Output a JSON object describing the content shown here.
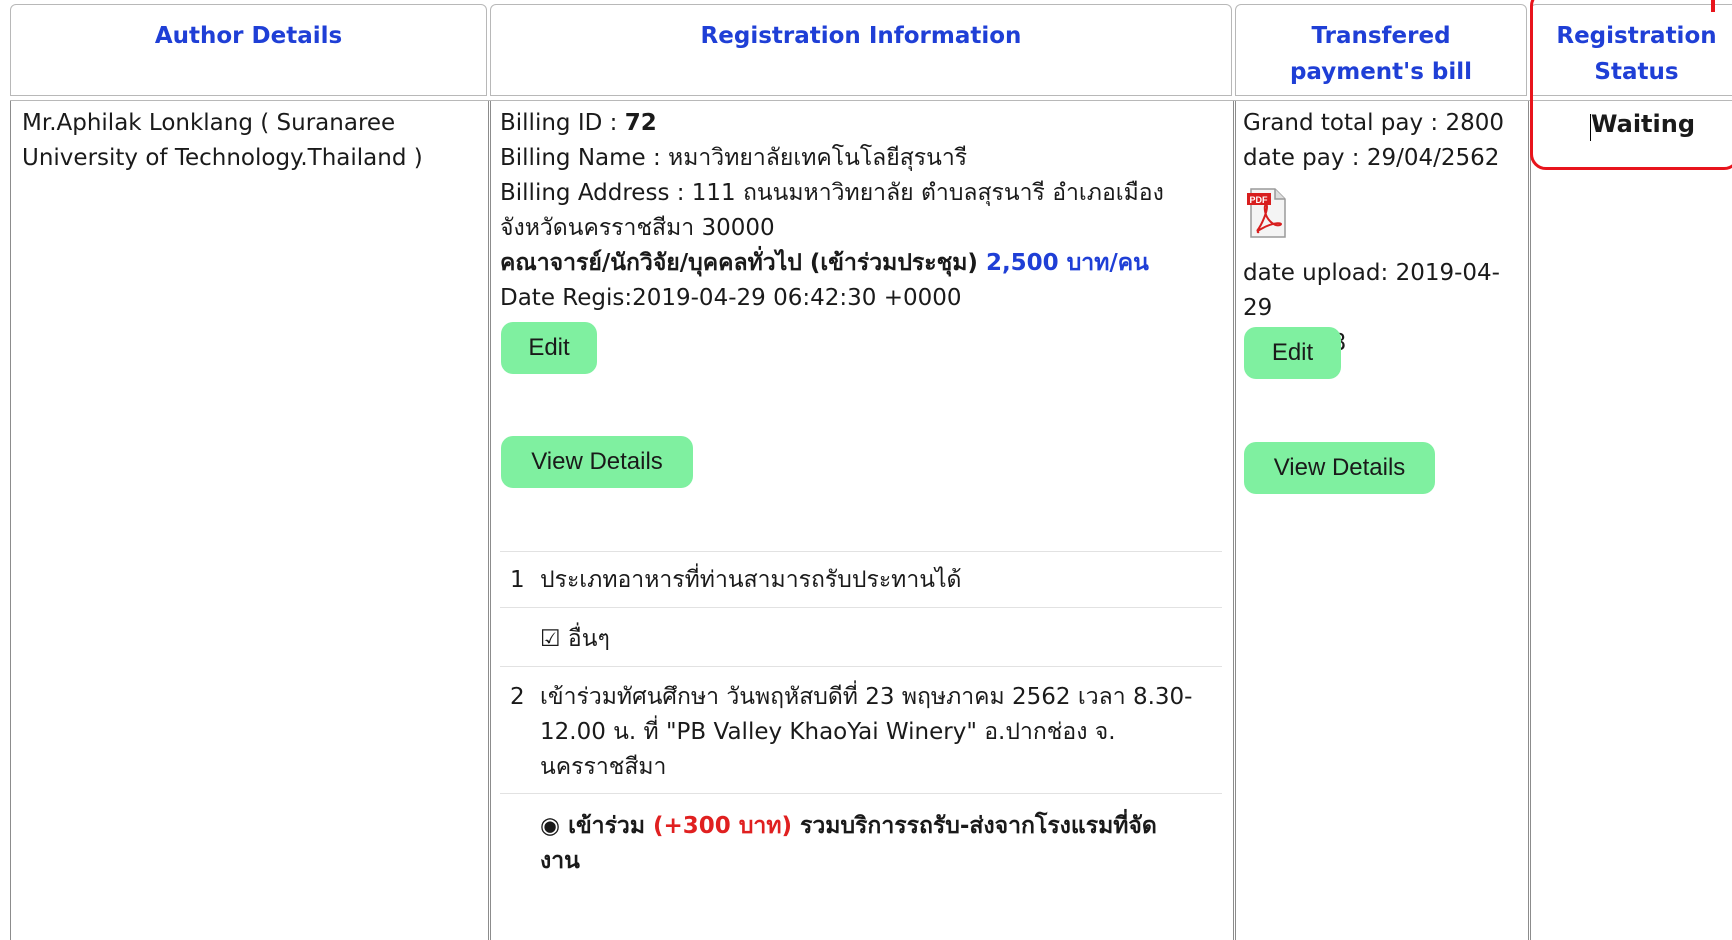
{
  "headers": {
    "author": "Author Details",
    "registration": "Registration Information",
    "bill": "Transfered payment's bill",
    "status": "Registration Status"
  },
  "author": {
    "line1": "Mr.Aphilak Lonklang ( Suranaree",
    "line2": "University of Technology.Thailand )"
  },
  "registration": {
    "billing_id_label": "Billing ID : ",
    "billing_id": "72",
    "billing_name": "Billing Name : หมาวิทยาลัยเทคโนโลยีสุรนารี",
    "billing_address_1": "Billing Address : 111 ถนนมหาวิทยาลัย ตำบลสุรนารี อำเภอเมือง",
    "billing_address_2": "จังหวัดนครราชสีมา 30000",
    "category": "คณาจารย์/นักวิจัย/บุคคลทั่วไป (เข้าร่วมประชุม) ",
    "price": "2,500 บาท/คน",
    "date_regis": "Date Regis:2019-04-29 06:42:30 +0000",
    "edit_label": "Edit",
    "view_label": "View Details",
    "questions": [
      {
        "num": "1",
        "text": "ประเภทอาหารที่ท่านสามารถรับประทานได้",
        "answer": "☑ อื่นๆ"
      },
      {
        "num": "2",
        "text_1": "เข้าร่วมทัศนศึกษา วันพฤหัสบดีที่ 23 พฤษภาคม 2562 เวลา 8.30-",
        "text_2": "12.00 น. ที่ \"PB Valley KhaoYai Winery\" อ.ปากช่อง จ.",
        "text_3": "นครราชสีมา",
        "answer_prefix": "◉ เข้าร่วม ",
        "answer_price": "(+300 บาท)",
        "answer_suffix_1": " รวมบริการรถรับ-ส่งจากโรงแรมที่จัด",
        "answer_suffix_2": "งาน"
      }
    ]
  },
  "bill": {
    "grand_total": "Grand total pay : 2800",
    "date_pay": "date pay : 29/04/2562",
    "date_upload_1": "date upload: 2019-04-29",
    "date_upload_2": "06:57:48",
    "edit_label": "Edit",
    "view_label": "View Details",
    "pdf_icon": "pdf-file-icon"
  },
  "status": {
    "value": "Waiting",
    "highlight_color": "#e8141c"
  }
}
